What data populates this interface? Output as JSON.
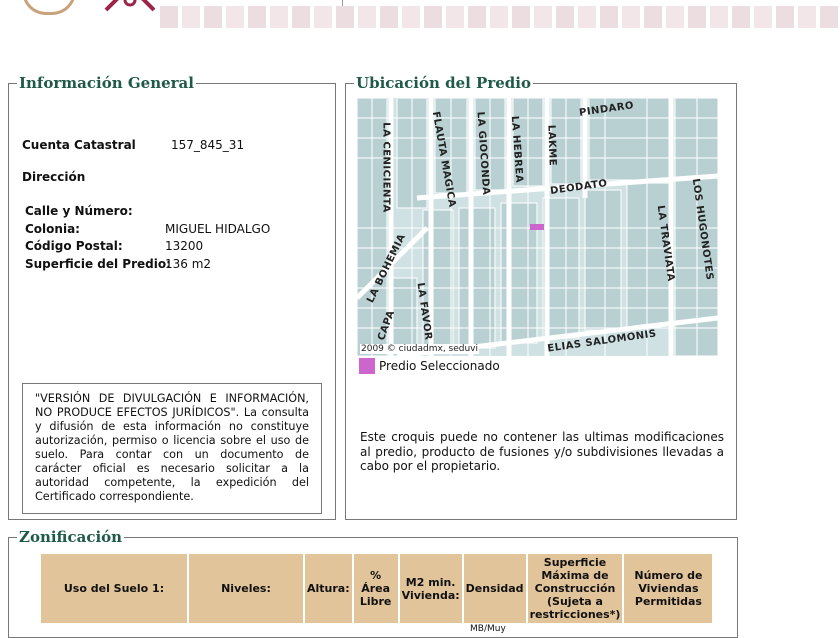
{
  "general": {
    "legend": "Información General",
    "cuenta_label": "Cuenta Catastral",
    "cuenta_value": "157_845_31",
    "direccion_label": "Dirección",
    "calle_label": "Calle y Número:",
    "calle_value": "",
    "colonia_label": "Colonia:",
    "colonia_value": "MIGUEL HIDALGO",
    "cp_label": "Código Postal:",
    "cp_value": "13200",
    "superficie_label": "Superficie del Predio:",
    "superficie_value": "136 m2",
    "disclaimer": "\"VERSIÓN DE DIVULGACIÓN E INFORMACIÓN, NO PRODUCE EFECTOS JURÍDICOS\". La consulta y difusión de esta información no constituye autorización, permiso o licencia sobre el uso de suelo. Para contar con un documento de carácter oficial es necesario solicitar a la autoridad competente, la expedición del Certificado correspondiente."
  },
  "ubicacion": {
    "legend": "Ubicación del Predio",
    "streets": [
      "PINDARO",
      "LA CENICIENTA",
      "FLAUTA MAGICA",
      "LA GIOCONDA",
      "LA HEBREA",
      "LAKME",
      "DEODATO",
      "LOS HUGONOTES",
      "LA TRAVIATA",
      "LA BOHEMIA",
      "LA FAVOR",
      "CAPA",
      "ELIAS SALOMONIS"
    ],
    "copyright": "2009 © ciudadmx, seduvi",
    "legend_item": "Predio Seleccionado",
    "note": "Este croquis puede no contener las ultimas modificaciones al predio, producto de fusiones y/o subdivisiones llevadas a cabo por el propietario.",
    "colors": {
      "map_bg": "#cfe1e3",
      "selected": "#cc66cc"
    }
  },
  "zonificacion": {
    "legend": "Zonificación",
    "headers": [
      "Uso del Suelo 1:",
      "Niveles:",
      "Altura:",
      "% Área Libre",
      "M2 min. Vivienda:",
      "Densidad",
      "Superficie Máxima de Construcción (Sujeta a restricciones*)",
      "Número de Viviendas Permitidas"
    ],
    "partial_cell": "MB/Muy"
  }
}
